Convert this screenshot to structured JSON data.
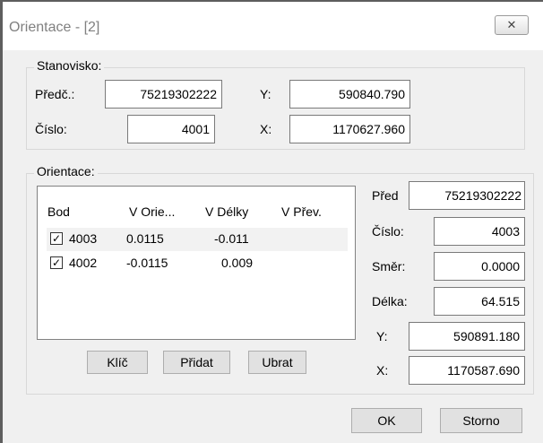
{
  "window": {
    "title": "Orientace - [2]",
    "close_glyph": "✕"
  },
  "stanovisko": {
    "legend": "Stanovisko:",
    "predc_label": "Předč.:",
    "predc_value": "75219302222",
    "cislo_label": "Číslo:",
    "cislo_value": "4001",
    "y_label": "Y:",
    "y_value": "590840.790",
    "x_label": "X:",
    "x_value": "1170627.960"
  },
  "orientace": {
    "legend": "Orientace:",
    "columns": [
      "Bod",
      "V Orie...",
      "V Délky",
      "V Přev."
    ],
    "rows": [
      {
        "checked": true,
        "bod": "4003",
        "v_orie": "0.0115",
        "v_delky": "-0.011",
        "v_prev": ""
      },
      {
        "checked": true,
        "bod": "4002",
        "v_orie": "-0.0115",
        "v_delky": "0.009",
        "v_prev": ""
      }
    ],
    "buttons": {
      "klic": "Klíč",
      "pridat": "Přidat",
      "ubrat": "Ubrat"
    },
    "pred_label": "Před",
    "pred_value": "75219302222",
    "cislo_label": "Číslo:",
    "cislo_value": "4003",
    "smer_label": "Směr:",
    "smer_value": "0.0000",
    "delka_label": "Délka:",
    "delka_value": "64.515",
    "y_label": "Y:",
    "y_value": "590891.180",
    "x_label": "X:",
    "x_value": "1170587.690"
  },
  "footer": {
    "ok": "OK",
    "storno": "Storno"
  },
  "icons": {
    "checkbox": "check-icon",
    "close": "close-icon"
  },
  "colors": {
    "client_bg": "#f0f0f0",
    "selected_row": "#f2f2f2",
    "frame": "#5e5e5e"
  }
}
